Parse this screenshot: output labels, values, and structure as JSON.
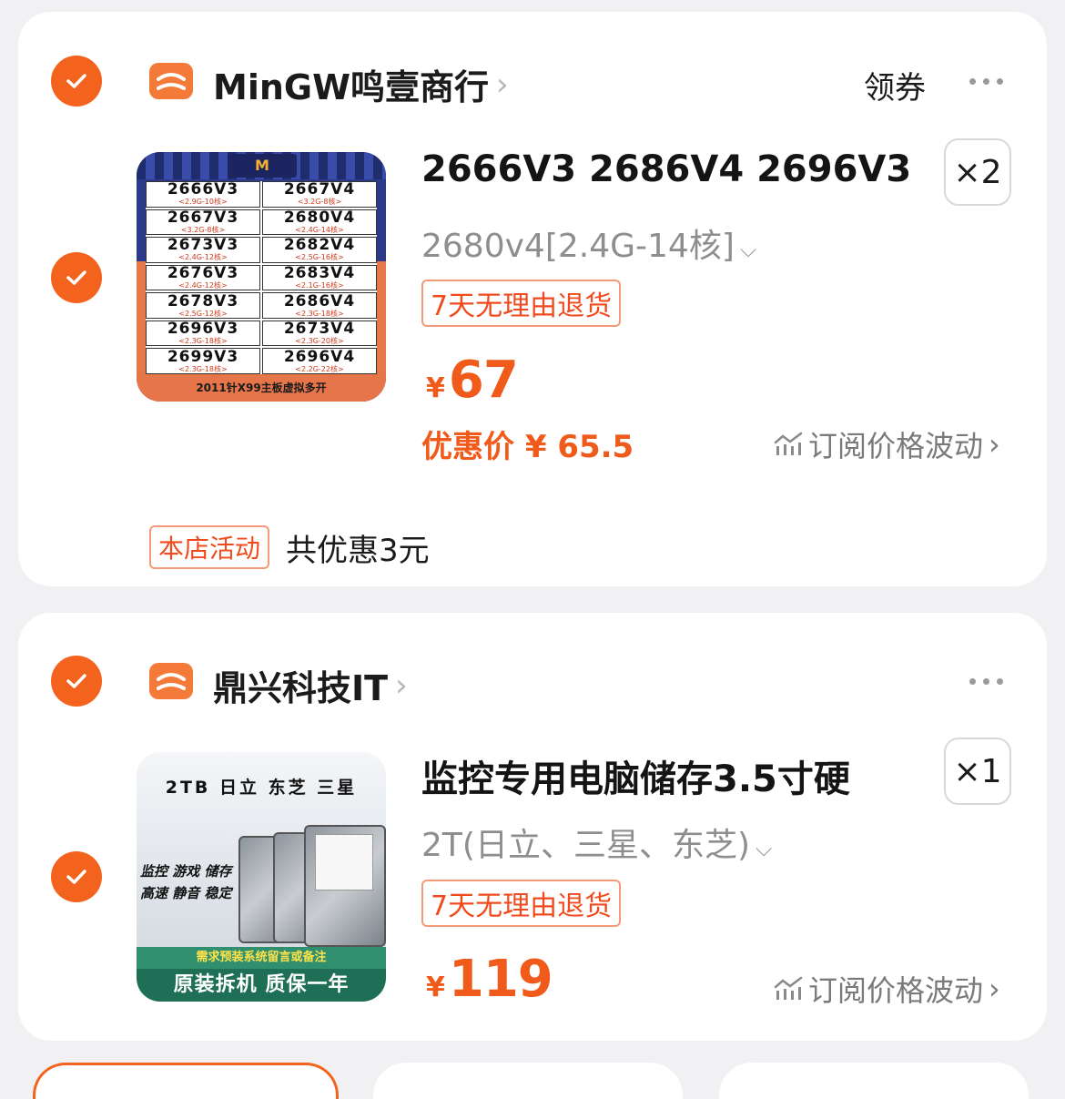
{
  "stores": [
    {
      "name": "MinGW鸣壹商行",
      "coupon_label": "领券",
      "item": {
        "title": "2666V3 2686V4 2696V3",
        "quantity": "×2",
        "sku": "2680v4[2.4G-14核]",
        "return_badge": "7天无理由退货",
        "price_symbol": "¥",
        "price": "67",
        "discount_label": "优惠价 ¥ 65.5",
        "subscribe_label": "订阅价格波动",
        "thumbnail": {
          "logo_text": "M",
          "cells": [
            {
              "model": "2666V3",
              "spec": "<2.9G-10核>"
            },
            {
              "model": "2667V4",
              "spec": "<3.2G-8核>"
            },
            {
              "model": "2667V3",
              "spec": "<3.2G-8核>"
            },
            {
              "model": "2680V4",
              "spec": "<2.4G-14核>"
            },
            {
              "model": "2673V3",
              "spec": "<2.4G-12核>"
            },
            {
              "model": "2682V4",
              "spec": "<2.5G-16核>"
            },
            {
              "model": "2676V3",
              "spec": "<2.4G-12核>"
            },
            {
              "model": "2683V4",
              "spec": "<2.1G-16核>"
            },
            {
              "model": "2678V3",
              "spec": "<2.5G-12核>"
            },
            {
              "model": "2686V4",
              "spec": "<2.3G-18核>"
            },
            {
              "model": "2696V3",
              "spec": "<2.3G-18核>"
            },
            {
              "model": "2673V4",
              "spec": "<2.3G-20核>"
            },
            {
              "model": "2699V3",
              "spec": "<2.3G-18核>"
            },
            {
              "model": "2696V4",
              "spec": "<2.2G-22核>"
            }
          ],
          "footer": "2011针X99主板虚拟多开"
        }
      },
      "store_activity_badge": "本店活动",
      "store_activity_text": "共优惠3元"
    },
    {
      "name": "鼎兴科技IT",
      "item": {
        "title": "监控专用电脑储存3.5寸硬",
        "quantity": "×1",
        "sku": "2T(日立、三星、东芝)",
        "return_badge": "7天无理由退货",
        "price_symbol": "¥",
        "price": "119",
        "subscribe_label": "订阅价格波动",
        "thumbnail": {
          "top_text": "2TB  日立  东芝  三星",
          "line1": "监控 游戏 储存",
          "line2": "高速 静音 稳定",
          "band1": "需求预装系统留言或备注",
          "band2": "原装拆机  质保一年"
        }
      }
    }
  ],
  "colors": {
    "accent": "#f4631e",
    "price": "#f05a1a",
    "background": "#f1f1f3"
  }
}
